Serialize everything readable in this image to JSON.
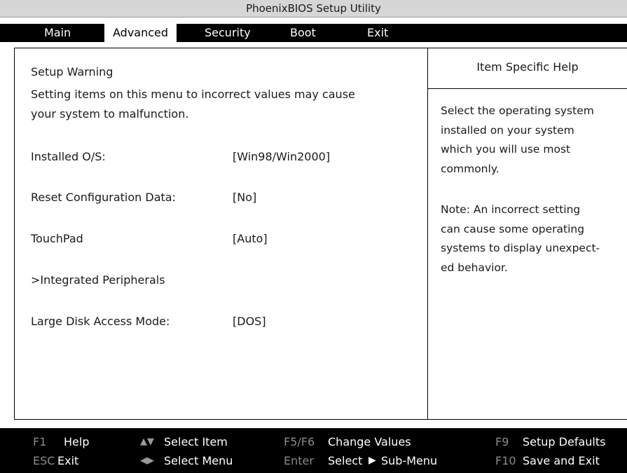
{
  "title": "PhoenixBIOS Setup Utility",
  "menu": {
    "main": "Main",
    "advanced": "Advanced",
    "security": "Security",
    "boot": "Boot",
    "exit": "Exit"
  },
  "warning": {
    "heading": "Setup Warning",
    "line1": "Setting items on this menu to incorrect values may cause",
    "line2": "your system to malfunction."
  },
  "settings": [
    {
      "label": "Installed O/S:",
      "value": "[Win98/Win2000]"
    },
    {
      "label": "Reset Configuration Data:",
      "value": "[No]"
    },
    {
      "label": "TouchPad",
      "value": "[Auto]"
    },
    {
      "label": ">Integrated Peripherals",
      "value": ""
    },
    {
      "label": "Large Disk Access Mode:",
      "value": "[DOS]"
    }
  ],
  "help": {
    "title": "Item Specific Help",
    "paragraph1": [
      "Select the operating system",
      "installed on your system",
      "which you will use most",
      "commonly."
    ],
    "paragraph2": [
      "Note: An incorrect setting",
      "can cause some operating",
      "systems to display unexpect-",
      "ed behavior."
    ]
  },
  "footer": {
    "f1_key": "F1",
    "f1_label": "Help",
    "updown_icon": "up-down-arrows-icon",
    "select_item": "Select Item",
    "f5f6_key": "F5/F6",
    "change_values": "Change Values",
    "f9_key": "F9",
    "setup_defaults": "Setup Defaults",
    "esc_key": "ESC",
    "esc_label": "Exit",
    "leftright_icon": "left-right-arrows-icon",
    "select_menu": "Select Menu",
    "enter_key": "Enter",
    "select": "Select",
    "submenu_icon": "triangle-right-icon",
    "sub_menu": "Sub-Menu",
    "f10_key": "F10",
    "save_exit": "Save and Exit"
  },
  "colors": {
    "menu_bar": "#000000",
    "title_bar": "#d6d6d6",
    "footer_key": "#8a8a8a"
  }
}
